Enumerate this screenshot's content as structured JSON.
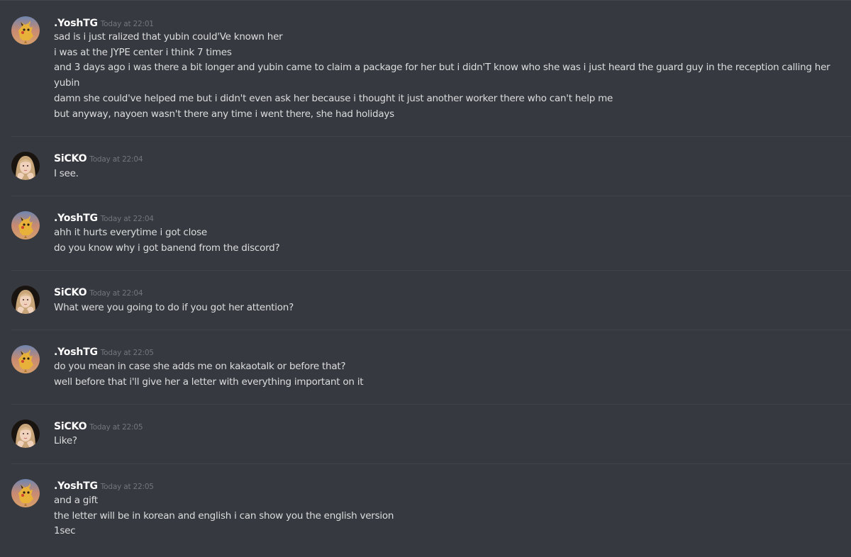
{
  "messages": [
    {
      "username": ".YoshTG",
      "avatar": "pikachu-avatar-icon",
      "timestamp": "Today at 22:01",
      "lines": [
        "sad is i just ralized that yubin could'Ve known her",
        "i was at the JYPE center i think 7 times",
        "and 3 days ago i was there a bit longer and yubin came to claim a package for her but i didn'T know who she was i just heard the guard guy in the reception calling her",
        "yubin",
        "damn she could've helped me but i didn't even ask her because i thought it just another worker there who can't help me",
        "but anyway, nayoen wasn't there any time i went there, she had holidays"
      ]
    },
    {
      "username": "SiCKO",
      "avatar": "girl-photo-avatar-icon",
      "timestamp": "Today at 22:04",
      "lines": [
        "I see."
      ]
    },
    {
      "username": ".YoshTG",
      "avatar": "pikachu-avatar-icon",
      "timestamp": "Today at 22:04",
      "lines": [
        "ahh it hurts everytime i got close",
        "do you know why i got banend from the discord?"
      ]
    },
    {
      "username": "SiCKO",
      "avatar": "girl-photo-avatar-icon",
      "timestamp": "Today at 22:04",
      "lines": [
        "What were you going to do if you got her attention?"
      ]
    },
    {
      "username": ".YoshTG",
      "avatar": "pikachu-avatar-icon",
      "timestamp": "Today at 22:05",
      "lines": [
        "do you mean in case she adds me on kakaotalk or before that?",
        "well before that i'll give her a letter with everything important on it"
      ]
    },
    {
      "username": "SiCKO",
      "avatar": "girl-photo-avatar-icon",
      "timestamp": "Today at 22:05",
      "lines": [
        "Like?"
      ]
    },
    {
      "username": ".YoshTG",
      "avatar": "pikachu-avatar-icon",
      "timestamp": "Today at 22:05",
      "lines": [
        "and a gift",
        "the letter will be in korean and english i can show you the english version",
        "1sec"
      ]
    }
  ],
  "colors": {
    "background": "#36393f",
    "username": "#ffffff",
    "timestamp": "#72767d",
    "text": "#dcddde",
    "divider": "#40434a"
  }
}
